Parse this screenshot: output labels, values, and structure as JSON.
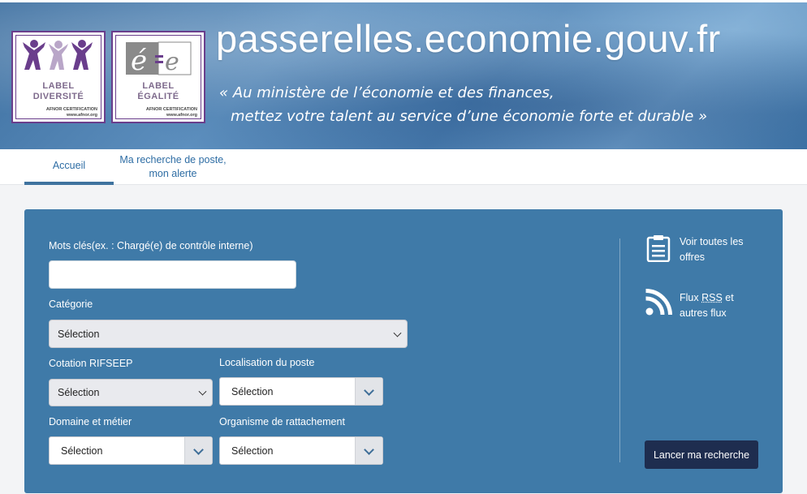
{
  "header": {
    "site_title": "passerelles.economie.gouv.fr",
    "tagline_line1": "« Au ministère de l’économie et des finances,",
    "tagline_line2": "mettez votre talent au service d’une économie forte et durable »",
    "label_diversite": {
      "line1": "LABEL",
      "line2": "DIVERSITÉ",
      "cert": "AFNOR CERTIFICATION",
      "url": "www.afnor.org"
    },
    "label_egalite": {
      "line1": "LABEL",
      "line2": "ÉGALITÉ",
      "cert": "AFNOR CERTIFICATION",
      "url": "www.afnor.org"
    }
  },
  "nav": {
    "tabs": [
      {
        "label": "Accueil",
        "active": true
      },
      {
        "label_line1": "Ma recherche de poste,",
        "label_line2": "mon alerte",
        "active": false
      }
    ]
  },
  "search": {
    "keywords_label": "Mots clés(ex. : Chargé(e) de contrôle interne)",
    "keywords_value": "",
    "categorie_label": "Catégorie",
    "categorie_value": "Sélection",
    "cotation_label": "Cotation RIFSEEP",
    "cotation_value": "Sélection",
    "localisation_label": "Localisation du poste",
    "localisation_value": "Sélection",
    "domaine_label": "Domaine et métier",
    "domaine_value": "Sélection",
    "organisme_label": "Organisme de rattachement",
    "organisme_value": "Sélection",
    "submit_label": "Lancer ma recherche"
  },
  "sidebar": {
    "offers_line1": "Voir toutes les",
    "offers_line2": "offres",
    "rss_prefix": "Flux ",
    "rss_abbr": "RSS",
    "rss_suffix": " et",
    "rss_line2": "autres flux"
  },
  "colors": {
    "panel": "#3f7aa8",
    "button": "#1e2d4f",
    "nav_link": "#2e6da4",
    "label_border": "#6a3e8c"
  }
}
